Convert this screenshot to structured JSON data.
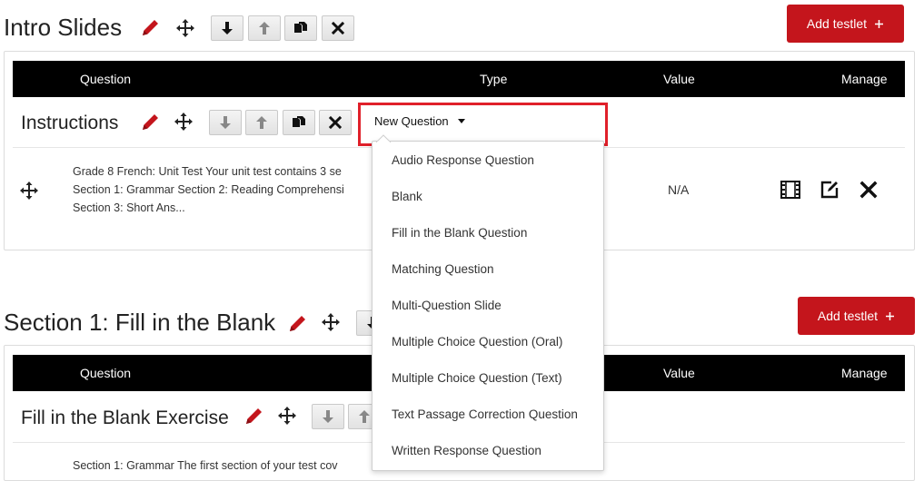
{
  "sections": [
    {
      "title": "Intro Slides",
      "add_testlet_label": "Add testlet",
      "columns": {
        "question": "Question",
        "type": "Type",
        "value": "Value",
        "manage": "Manage"
      },
      "testlet": {
        "title": "Instructions",
        "new_question_label": "New Question",
        "row": {
          "text_lines": [
            "Grade 8 French: Unit Test Your unit test contains 3 se",
            "Section 1: Grammar Section 2: Reading Comprehensi",
            "Section 3: Short Ans..."
          ],
          "value": "N/A"
        }
      }
    },
    {
      "title": "Section 1: Fill in the Blank",
      "add_testlet_label": "Add testlet",
      "columns": {
        "question": "Question",
        "value": "Value",
        "manage": "Manage"
      },
      "testlet": {
        "title": "Fill in the Blank Exercise",
        "row": {
          "text_lines": [
            "Section 1: Grammar The first section of your test cov"
          ]
        }
      }
    }
  ],
  "dropdown": {
    "items": [
      "Audio Response Question",
      "Blank",
      "Fill in the Blank Question",
      "Matching Question",
      "Multi-Question Slide",
      "Multiple Choice Question (Oral)",
      "Multiple Choice Question (Text)",
      "Text Passage Correction Question",
      "Written Response Question"
    ]
  },
  "colors": {
    "accent": "#c4151c",
    "highlight": "#e0202a",
    "header": "#000000"
  },
  "icons": {
    "edit": "pencil-icon",
    "move": "move-icon",
    "down": "arrow-down-icon",
    "up": "arrow-up-icon",
    "copy": "copy-icon",
    "delete": "close-icon",
    "add": "plus-icon",
    "caret": "caret-down-icon",
    "preview": "film-icon",
    "edit_row": "edit-square-icon"
  }
}
